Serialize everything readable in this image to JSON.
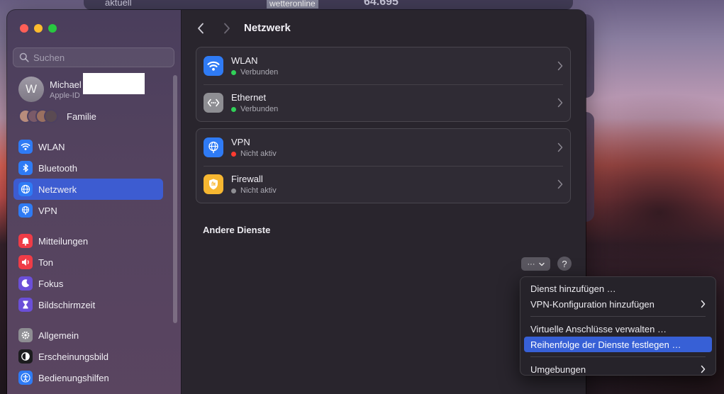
{
  "background": {
    "widget_left_text": "aktuell",
    "widget_badge": "wetteronline",
    "widget_number": "64.695"
  },
  "sidebar": {
    "search_placeholder": "Suchen",
    "account": {
      "initial": "W",
      "name": "Michael",
      "subtitle": "Apple-ID"
    },
    "family_label": "Familie",
    "groups": [
      [
        {
          "label": "WLAN",
          "icon": "wifi-icon",
          "color": "#2f7bf5"
        },
        {
          "label": "Bluetooth",
          "icon": "bluetooth-icon",
          "color": "#2f7bf5"
        },
        {
          "label": "Netzwerk",
          "icon": "globe-icon",
          "color": "#2f7bf5",
          "active": true
        },
        {
          "label": "VPN",
          "icon": "vpn-globe-icon",
          "color": "#2f7bf5"
        }
      ],
      [
        {
          "label": "Mitteilungen",
          "icon": "bell-icon",
          "color": "#ef3c47"
        },
        {
          "label": "Ton",
          "icon": "speaker-icon",
          "color": "#ef3c47"
        },
        {
          "label": "Fokus",
          "icon": "moon-icon",
          "color": "#6b4fd8"
        },
        {
          "label": "Bildschirmzeit",
          "icon": "hourglass-icon",
          "color": "#6b4fd8"
        }
      ],
      [
        {
          "label": "Allgemein",
          "icon": "gear-icon",
          "color": "#8e8e93"
        },
        {
          "label": "Erscheinungsbild",
          "icon": "appearance-icon",
          "color": "#1c1c1e"
        },
        {
          "label": "Bedienungshilfen",
          "icon": "accessibility-icon",
          "color": "#2f7bf5"
        }
      ]
    ]
  },
  "main": {
    "title": "Netzwerk",
    "cards": [
      [
        {
          "title": "WLAN",
          "status": "Verbunden",
          "status_color": "#30d158",
          "icon": "wifi-icon",
          "icon_color": "#2f7bf5"
        },
        {
          "title": "Ethernet",
          "status": "Verbunden",
          "status_color": "#30d158",
          "icon": "ethernet-icon",
          "icon_color": "#8e8e93"
        }
      ],
      [
        {
          "title": "VPN",
          "status": "Nicht aktiv",
          "status_color": "#ff3b30",
          "icon": "vpn-globe-icon",
          "icon_color": "#2f7bf5"
        },
        {
          "title": "Firewall",
          "status": "Nicht aktiv",
          "status_color": "#8e8e93",
          "icon": "firewall-shield-icon",
          "icon_color": "#f7b731"
        }
      ]
    ],
    "other_services_title": "Andere Dienste",
    "more_button_label": "···",
    "help_label": "?"
  },
  "context_menu": {
    "items": [
      {
        "label": "Dienst hinzufügen …",
        "submenu": false
      },
      {
        "label": "VPN-Konfiguration hinzufügen",
        "submenu": true
      },
      {
        "separator": true
      },
      {
        "label": "Virtuelle Anschlüsse verwalten …",
        "submenu": false
      },
      {
        "label": "Reihenfolge der Dienste festlegen …",
        "submenu": false,
        "highlighted": true
      },
      {
        "separator": true
      },
      {
        "label": "Umgebungen",
        "submenu": true
      }
    ]
  }
}
